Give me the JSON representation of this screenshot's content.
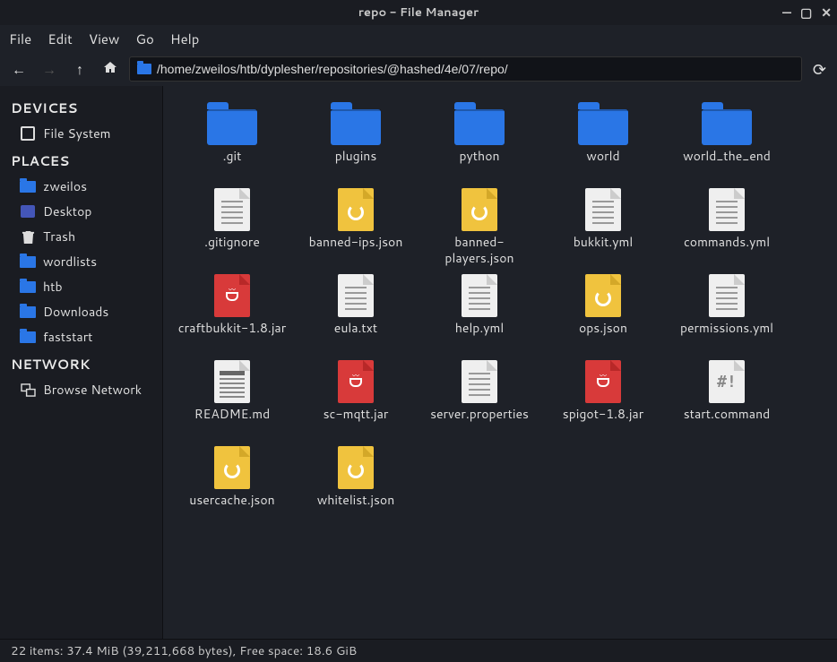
{
  "window": {
    "title": "repo - File Manager"
  },
  "menu": {
    "file": "File",
    "edit": "Edit",
    "view": "View",
    "go": "Go",
    "help": "Help"
  },
  "toolbar": {
    "path": "/home/zweilos/htb/dyplesher/repositories/@hashed/4e/07/repo/"
  },
  "sidebar": {
    "sections": [
      {
        "title": "DEVICES",
        "items": [
          {
            "label": "File System",
            "icon": "disk"
          }
        ]
      },
      {
        "title": "PLACES",
        "items": [
          {
            "label": "zweilos",
            "icon": "folder"
          },
          {
            "label": "Desktop",
            "icon": "desktop"
          },
          {
            "label": "Trash",
            "icon": "trash"
          },
          {
            "label": "wordlists",
            "icon": "folder"
          },
          {
            "label": "htb",
            "icon": "folder"
          },
          {
            "label": "Downloads",
            "icon": "folder"
          },
          {
            "label": "faststart",
            "icon": "folder"
          }
        ]
      },
      {
        "title": "NETWORK",
        "items": [
          {
            "label": "Browse Network",
            "icon": "network"
          }
        ]
      }
    ]
  },
  "files": [
    {
      "name": ".git",
      "type": "folder"
    },
    {
      "name": "plugins",
      "type": "folder"
    },
    {
      "name": "python",
      "type": "folder"
    },
    {
      "name": "world",
      "type": "folder"
    },
    {
      "name": "world_the_end",
      "type": "folder"
    },
    {
      "name": ".gitignore",
      "type": "plain"
    },
    {
      "name": "banned-ips.json",
      "type": "json"
    },
    {
      "name": "banned-players.json",
      "type": "json"
    },
    {
      "name": "bukkit.yml",
      "type": "plain"
    },
    {
      "name": "commands.yml",
      "type": "plain"
    },
    {
      "name": "craftbukkit-1.8.jar",
      "type": "jar"
    },
    {
      "name": "eula.txt",
      "type": "plain"
    },
    {
      "name": "help.yml",
      "type": "plain"
    },
    {
      "name": "ops.json",
      "type": "json"
    },
    {
      "name": "permissions.yml",
      "type": "plain"
    },
    {
      "name": "README.md",
      "type": "md"
    },
    {
      "name": "sc-mqtt.jar",
      "type": "jar"
    },
    {
      "name": "server.properties",
      "type": "plain"
    },
    {
      "name": "spigot-1.8.jar",
      "type": "jar"
    },
    {
      "name": "start.command",
      "type": "shell"
    },
    {
      "name": "usercache.json",
      "type": "json"
    },
    {
      "name": "whitelist.json",
      "type": "json"
    }
  ],
  "status": "22 items: 37.4 MiB (39,211,668 bytes), Free space: 18.6 GiB"
}
